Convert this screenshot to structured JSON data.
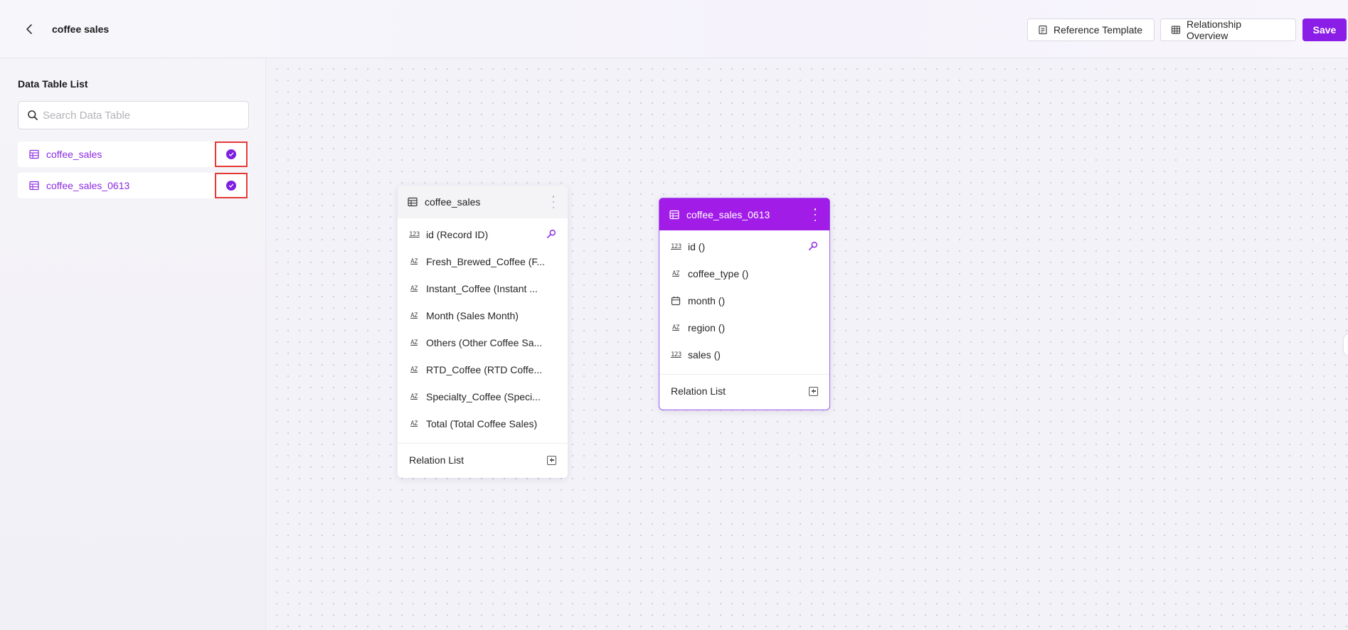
{
  "header": {
    "title": "coffee sales",
    "reference_template_label": "Reference Template",
    "relationship_overview_label": "Relationship Overview",
    "save_label": "Save"
  },
  "sidebar": {
    "title": "Data Table List",
    "search_placeholder": "Search Data Table",
    "search_value": "",
    "items": [
      {
        "label": "coffee_sales",
        "selected": true
      },
      {
        "label": "coffee_sales_0613",
        "selected": true
      }
    ]
  },
  "canvas": {
    "cards": [
      {
        "title": "coffee_sales",
        "fields": [
          {
            "type": "123",
            "label": "id (Record ID)",
            "key": true
          },
          {
            "type": "AZ",
            "label": "Fresh_Brewed_Coffee (F..."
          },
          {
            "type": "AZ",
            "label": "Instant_Coffee (Instant ..."
          },
          {
            "type": "AZ",
            "label": "Month (Sales Month)"
          },
          {
            "type": "AZ",
            "label": "Others (Other Coffee Sa..."
          },
          {
            "type": "AZ",
            "label": "RTD_Coffee (RTD Coffe..."
          },
          {
            "type": "AZ",
            "label": "Specialty_Coffee (Speci..."
          },
          {
            "type": "AZ",
            "label": "Total (Total Coffee Sales)"
          }
        ],
        "relation_label": "Relation List"
      },
      {
        "title": "coffee_sales_0613",
        "fields": [
          {
            "type": "123",
            "label": "id ()",
            "key": true
          },
          {
            "type": "AZ",
            "label": "coffee_type ()"
          },
          {
            "type": "date",
            "label": "month ()"
          },
          {
            "type": "AZ",
            "label": "region ()"
          },
          {
            "type": "123",
            "label": "sales ()"
          }
        ],
        "relation_label": "Relation List"
      }
    ]
  },
  "colors": {
    "accent": "#8a1de6",
    "card_header_active": "#a21ce8",
    "selection_highlight": "#e53935"
  }
}
